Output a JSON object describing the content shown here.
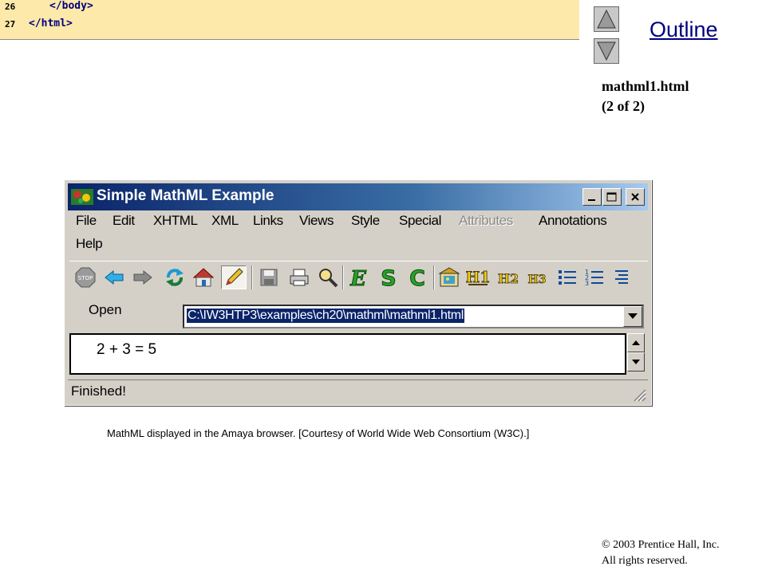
{
  "code": {
    "lines": [
      {
        "num": "26",
        "text": "</body>"
      },
      {
        "num": "27",
        "text": "</html>"
      }
    ]
  },
  "outline": {
    "label": "Outline",
    "file": "mathml1.html",
    "part": "(2 of 2)",
    "up_icon": "triangle-up-icon",
    "down_icon": "triangle-down-icon"
  },
  "window": {
    "title": "Simple MathML Example",
    "menu": [
      "File",
      "Edit",
      "XHTML",
      "XML",
      "Links",
      "Views",
      "Style",
      "Special",
      "Attributes",
      "Annotations",
      "Help"
    ],
    "disabled_menu": "Attributes",
    "toolbar_icons": [
      "stop-icon",
      "back-arrow-icon",
      "forward-arrow-icon",
      "reload-icon",
      "home-icon",
      "edit-pencil-icon",
      "save-icon",
      "print-icon",
      "find-icon",
      "emphasis-icon",
      "strong-icon",
      "code-icon",
      "image-icon",
      "heading1-icon",
      "heading2-icon",
      "heading3-icon",
      "bulleted-list-icon",
      "numbered-list-icon",
      "definition-list-icon"
    ],
    "open_label": "Open",
    "url": "C:\\IW3HTP3\\examples\\ch20\\mathml\\mathml1.html",
    "math": "2 + 3 = 5",
    "status": "Finished!"
  },
  "caption": "MathML displayed in the Amaya browser. [Courtesy of World Wide Web Consortium (W3C).]",
  "copyright": {
    "line1": "© 2003 Prentice Hall, Inc.",
    "line2": "All rights reserved."
  }
}
